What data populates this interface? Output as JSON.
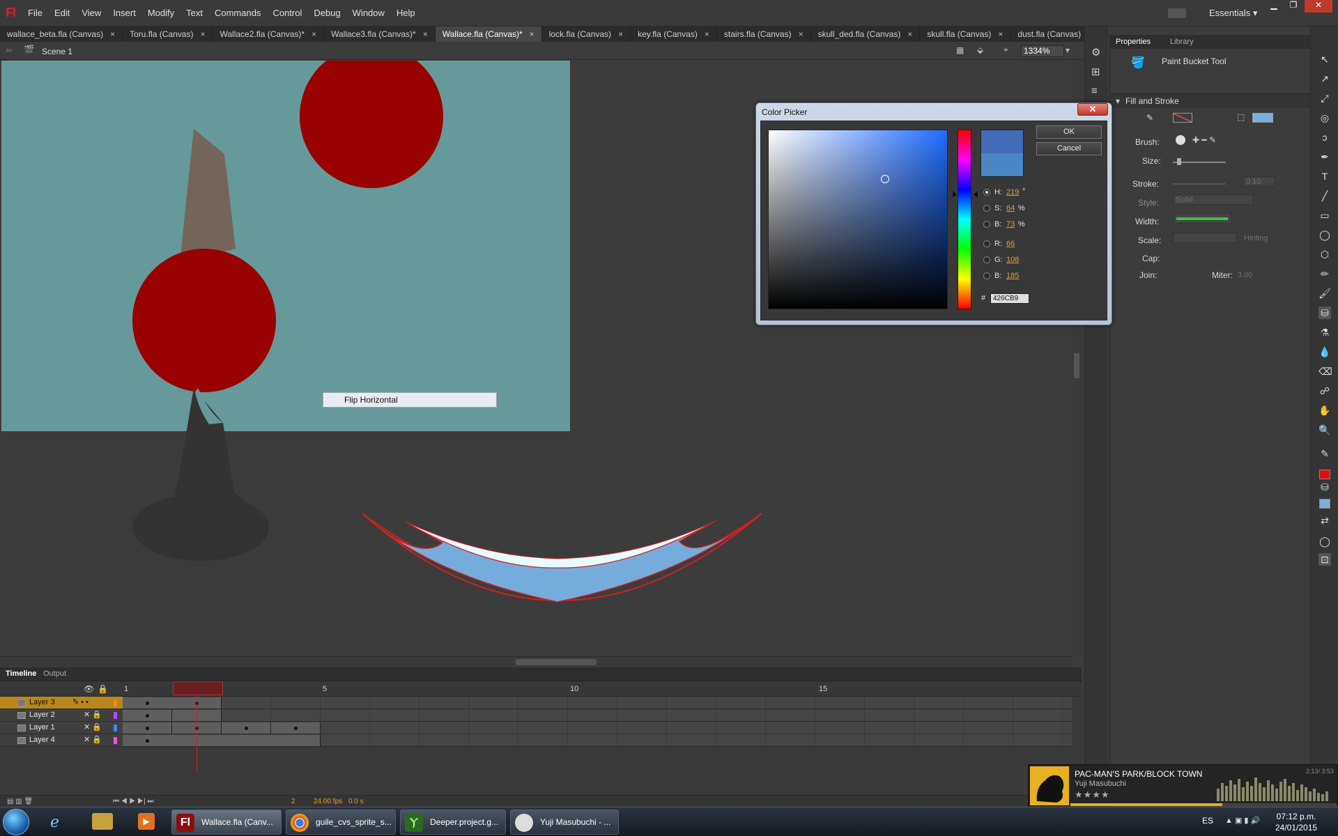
{
  "menubar": {
    "logo": "Fl",
    "items": [
      "File",
      "Edit",
      "View",
      "Insert",
      "Modify",
      "Text",
      "Commands",
      "Control",
      "Debug",
      "Window",
      "Help"
    ],
    "workspace": "Essentials ▾"
  },
  "tabs": [
    {
      "label": "wallace_beta.fla (Canvas)",
      "active": false
    },
    {
      "label": "Toru.fla (Canvas)",
      "active": false
    },
    {
      "label": "Wallace2.fla (Canvas)*",
      "active": false
    },
    {
      "label": "Wallace3.fla (Canvas)*",
      "active": false
    },
    {
      "label": "Wallace.fla (Canvas)*",
      "active": true
    },
    {
      "label": "lock.fla (Canvas)",
      "active": false
    },
    {
      "label": "key.fla (Canvas)",
      "active": false
    },
    {
      "label": "stairs.fla (Canvas)",
      "active": false
    },
    {
      "label": "skull_ded.fla (Canvas)",
      "active": false
    },
    {
      "label": "skull.fla (Canvas)",
      "active": false
    },
    {
      "label": "dust.fla (Canvas)",
      "active": false
    }
  ],
  "editbar": {
    "scene": "Scene 1",
    "zoom": "1334%"
  },
  "stage": {
    "canvas_color": "#669999",
    "tooltip": "Flip Horizontal"
  },
  "color_picker": {
    "title": "Color Picker",
    "ok": "OK",
    "cancel": "Cancel",
    "h": "219",
    "s": "64",
    "b_hsb": "73",
    "r": "66",
    "g": "108",
    "b_rgb": "185",
    "hex": "426CB9",
    "hash": "#",
    "labels": {
      "h": "H:",
      "s": "S:",
      "b": "B:",
      "r": "R:",
      "g": "G:",
      "b2": "B:"
    },
    "units": {
      "deg": "°",
      "pct": "%"
    },
    "new_color": "#426CB9",
    "old_color": "#4a86c4"
  },
  "timeline": {
    "tabs": [
      "Timeline",
      "Output"
    ],
    "frame_numbers": [
      "1",
      "5",
      "10",
      "15"
    ],
    "layers": [
      {
        "name": "Layer 3",
        "selected": true,
        "color": "#f08a1c"
      },
      {
        "name": "Layer 2",
        "selected": false,
        "color": "#b04cff"
      },
      {
        "name": "Layer 1",
        "selected": false,
        "color": "#4c7cff"
      },
      {
        "name": "Layer 4",
        "selected": false,
        "color": "#ff4cf0"
      }
    ],
    "current_frame": "2",
    "fps": "24.00 fps",
    "time": "0.0 s"
  },
  "properties": {
    "tabs": [
      "Properties",
      "Library"
    ],
    "tool": "Paint Bucket Tool",
    "section": "Fill and Stroke",
    "brush": "Brush:",
    "size": "Size:",
    "stroke": "Stroke:",
    "stroke_value": "0.10",
    "style": "Style:",
    "style_value": "Solid",
    "width": "Width:",
    "scale": "Scale:",
    "hinting": "Hinting",
    "cap": "Cap:",
    "join": "Join:",
    "miter": "Miter:",
    "miter_value": "3.00",
    "fill_color": "#7ab0e0",
    "stroke_color": "#e05050"
  },
  "music": {
    "title": "PAC-MAN'S PARK/BLOCK TOWN",
    "artist": "Yuji Masubuchi",
    "time": "2:13/ 3:53",
    "stars": "★★★★",
    "progress": 0.57
  },
  "taskbar": {
    "tasks": [
      "Wallace.fla (Canv...",
      "guile_cvs_sprite_s...",
      "Deeper.project.g...",
      "Yuji Masubuchi - ..."
    ],
    "lang": "ES",
    "time": "07:12 p.m.",
    "date": "24/01/2015"
  }
}
